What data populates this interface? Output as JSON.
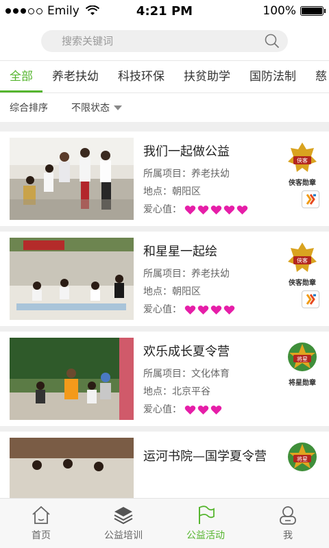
{
  "status": {
    "carrier": "Emily",
    "time": "4:21 PM",
    "battery": "100%"
  },
  "search": {
    "placeholder": "搜索关键词"
  },
  "tabs": [
    "全部",
    "养老扶幼",
    "科技环保",
    "扶贫助学",
    "国防法制",
    "慈"
  ],
  "filters": {
    "sort": "综合排序",
    "status": "不限状态"
  },
  "items": [
    {
      "title": "我们一起做公益",
      "project": "所属项目：养老扶幼",
      "location": "地点：朝阳区",
      "love_label": "爱心值：",
      "hearts": 5,
      "badge": "侠客勋章",
      "badge_text": "侠客"
    },
    {
      "title": "和星星一起绘",
      "project": "所属项目：养老扶幼",
      "location": "地点：朝阳区",
      "love_label": "爱心值：",
      "hearts": 4,
      "badge": "侠客勋章",
      "badge_text": "侠客"
    },
    {
      "title": "欢乐成长夏令营",
      "project": "所属项目：文化体育",
      "location": "地点：北京平谷",
      "love_label": "爱心值：",
      "hearts": 3,
      "badge": "将星勋章",
      "badge_text": "将星"
    },
    {
      "title": "运河书院—国学夏令营",
      "badge_text": "将星"
    }
  ],
  "bottom_nav": [
    {
      "label": "首页",
      "icon": "home-icon"
    },
    {
      "label": "公益培训",
      "icon": "layers-icon"
    },
    {
      "label": "公益活动",
      "icon": "flag-icon"
    },
    {
      "label": "我",
      "icon": "user-icon"
    }
  ],
  "colors": {
    "accent": "#55b52e",
    "heart": "#e61ea8"
  }
}
